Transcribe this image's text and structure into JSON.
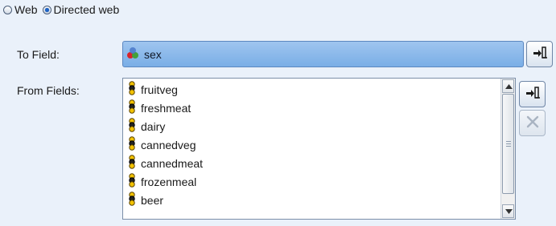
{
  "radio": {
    "options": [
      {
        "label": "Web",
        "checked": false
      },
      {
        "label": "Directed web",
        "checked": true
      }
    ]
  },
  "to_field": {
    "label": "To Field:",
    "value": "sex",
    "icon": "nominal-set-icon"
  },
  "from_fields": {
    "label": "From Fields:",
    "items": [
      "fruitveg",
      "freshmeat",
      "dairy",
      "cannedveg",
      "cannedmeat",
      "frozenmeal",
      "beer"
    ],
    "item_icon": "flag-field-icon"
  },
  "buttons": {
    "pick_to_field": "field-picker-icon",
    "pick_from_fields": "field-picker-icon",
    "remove": "delete-x-icon"
  },
  "colors": {
    "background": "#eaf1fa",
    "selected_field": "#8ab8ea",
    "radio_dot": "#1b63c7"
  }
}
